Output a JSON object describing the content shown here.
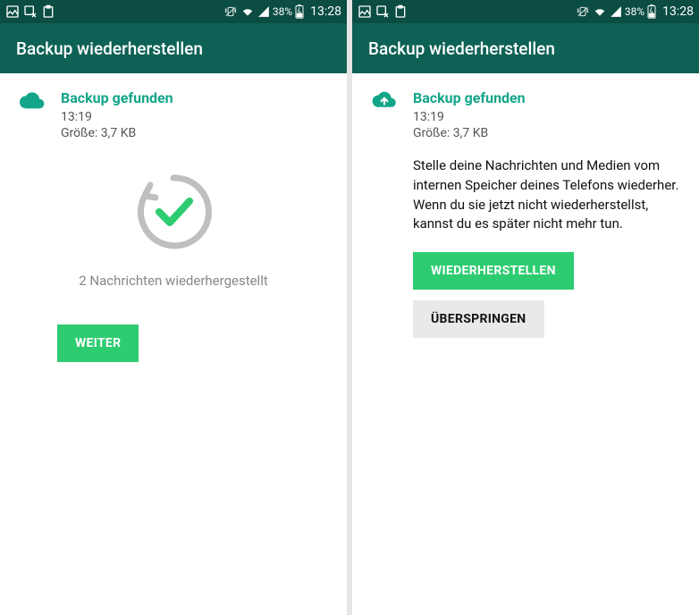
{
  "status": {
    "battery_pct": "38%",
    "time": "13:28"
  },
  "left": {
    "title": "Backup wiederherstellen",
    "backup": {
      "found_label": "Backup gefunden",
      "time": "13:19",
      "size_label": "Größe: 3,7 KB"
    },
    "restored_text": "2 Nachrichten wiederhergestellt",
    "continue_btn": "WEITER"
  },
  "right": {
    "title": "Backup wiederherstellen",
    "backup": {
      "found_label": "Backup gefunden",
      "time": "13:19",
      "size_label": "Größe: 3,7 KB"
    },
    "description": "Stelle deine Nachrichten und Medien vom internen Speicher deines Telefons wiederher. Wenn du sie jetzt nicht wiederherstellst, kannst du es später nicht mehr tun.",
    "restore_btn": "WIEDERHERSTELLEN",
    "skip_btn": "ÜBERSPRINGEN"
  }
}
